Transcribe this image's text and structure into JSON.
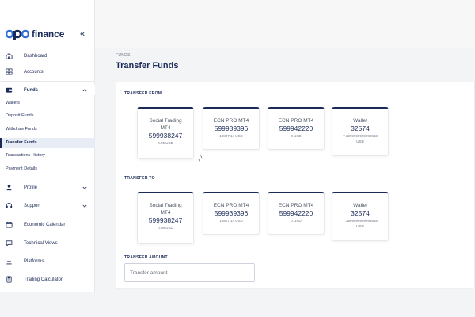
{
  "brand": {
    "logo_mark": "opo",
    "name": "finance"
  },
  "sidebar": {
    "collapse_icon": "«",
    "items": [
      {
        "label": "Dashboard",
        "icon": "home-icon"
      },
      {
        "label": "Accounts",
        "icon": "grid-icon"
      },
      {
        "label": "Funds",
        "icon": "wallet-icon",
        "expanded": true
      },
      {
        "label": "Profile",
        "icon": "user-icon"
      },
      {
        "label": "Support",
        "icon": "support-icon"
      },
      {
        "label": "Economic Calendar",
        "icon": "calendar-icon"
      },
      {
        "label": "Technical Views",
        "icon": "chat-icon"
      },
      {
        "label": "Platforms",
        "icon": "download-icon"
      },
      {
        "label": "Trading Calculator",
        "icon": "calculator-icon"
      }
    ],
    "funds_sub": [
      {
        "label": "Wallets"
      },
      {
        "label": "Deposit Funds"
      },
      {
        "label": "Withdraw Funds"
      },
      {
        "label": "Transfer Funds",
        "active": true
      },
      {
        "label": "Transactions History"
      },
      {
        "label": "Payment Details"
      }
    ]
  },
  "main": {
    "breadcrumb": "FUNDS",
    "title": "Transfer Funds",
    "transfer_from": {
      "label": "TRANSFER FROM",
      "accounts": [
        {
          "name_line1": "Social Trading",
          "name_line2": "MT4",
          "number": "599938247",
          "balance": "0.05 USD"
        },
        {
          "name_line1": "ECN PRO MT4",
          "name_line2": "",
          "number": "599939396",
          "balance": "10807.14 USD"
        },
        {
          "name_line1": "ECN PRO MT4",
          "name_line2": "",
          "number": "599942220",
          "balance": "0 USD"
        },
        {
          "name_line1": "Wallet",
          "name_line2": "",
          "number": "32574",
          "balance": "7.1999999999999818",
          "balance_unit": "USD"
        }
      ]
    },
    "transfer_to": {
      "label": "TRANSFER TO",
      "accounts": [
        {
          "name_line1": "Social Trading",
          "name_line2": "MT4",
          "number": "599938247",
          "balance": "0.05 USD"
        },
        {
          "name_line1": "ECN PRO MT4",
          "name_line2": "",
          "number": "599939396",
          "balance": "10807.14 USD"
        },
        {
          "name_line1": "ECN PRO MT4",
          "name_line2": "",
          "number": "599942220",
          "balance": "0 USD"
        },
        {
          "name_line1": "Wallet",
          "name_line2": "",
          "number": "32574",
          "balance": "7.1999999999999818",
          "balance_unit": "USD"
        }
      ]
    },
    "amount": {
      "label": "TRANSFER AMOUNT",
      "placeholder": "Transfer amount",
      "value": ""
    }
  },
  "colors": {
    "brand": "#1b2a57",
    "accent_blue": "#2f6fd8",
    "active_bg": "#e8ecf5"
  }
}
